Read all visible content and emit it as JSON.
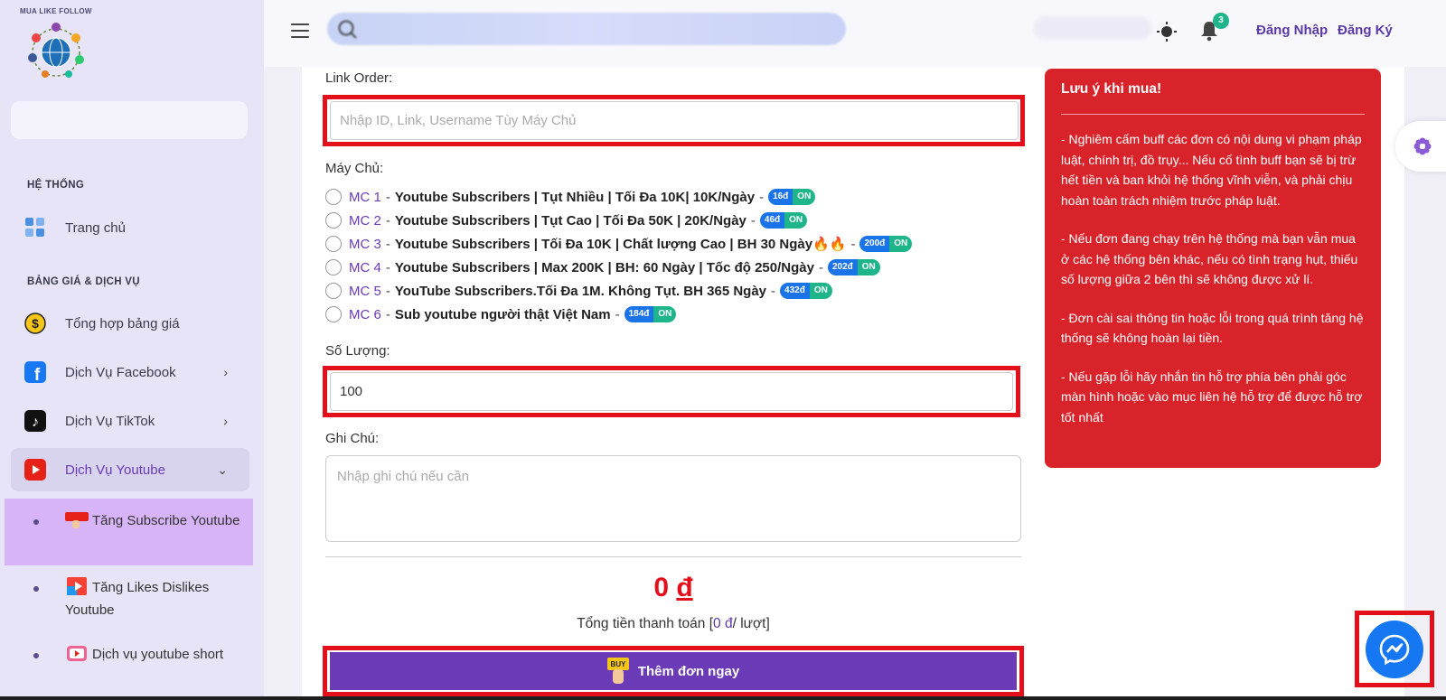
{
  "logo": {
    "text": "MUA LIKE FOLLOW"
  },
  "sidebar": {
    "section1": "HỆ THỐNG",
    "home": "Trang chủ",
    "section2": "BẢNG GIÁ & DỊCH VỤ",
    "items": [
      {
        "label": "Tổng hợp bảng giá"
      },
      {
        "label": "Dịch Vụ Facebook"
      },
      {
        "label": "Dịch Vụ TikTok"
      },
      {
        "label": "Dịch Vụ Youtube"
      }
    ],
    "sub_items": [
      {
        "label": "Tăng Subscribe Youtube"
      },
      {
        "label": "Tăng Likes Dislikes Youtube"
      },
      {
        "label": "Dịch vụ youtube short"
      }
    ]
  },
  "topbar": {
    "notif_count": "3",
    "login": "Đăng Nhập",
    "register": "Đăng Ký"
  },
  "form": {
    "link_label": "Link Order:",
    "link_placeholder": "Nhập ID, Link, Username Tùy Máy Chủ",
    "server_label": "Máy Chủ:",
    "servers": [
      {
        "code": "MC 1",
        "name": "Youtube Subscribers | Tụt Nhiều | Tối Đa 10K| 10K/Ngày",
        "price": "16đ",
        "status": "ON"
      },
      {
        "code": "MC 2",
        "name": "Youtube Subscribers | Tụt Cao | Tối Đa 50K | 20K/Ngày",
        "price": "46đ",
        "status": "ON"
      },
      {
        "code": "MC 3",
        "name": "Youtube Subscribers | Tối Đa 10K | Chất lượng Cao | BH 30 Ngày🔥🔥",
        "price": "200đ",
        "status": "ON"
      },
      {
        "code": "MC 4",
        "name": "Youtube Subscribers | Max 200K | BH: 60 Ngày | Tốc độ 250/Ngày",
        "price": "202đ",
        "status": "ON"
      },
      {
        "code": "MC 5",
        "name": "YouTube Subscribers.Tối Đa 1M. Không Tụt. BH 365 Ngày",
        "price": "432đ",
        "status": "ON"
      },
      {
        "code": "MC 6",
        "name": "Sub youtube người thật Việt Nam",
        "price": "184đ",
        "status": "ON"
      }
    ],
    "dash": "-",
    "qty_label": "Số Lượng:",
    "qty_value": "100",
    "note_label": "Ghi Chú:",
    "note_placeholder": "Nhập ghi chú nếu cần",
    "total_amount": "0",
    "total_currency": "đ",
    "total_label_prefix": "Tổng tiền thanh toán [",
    "total_label_price": "0 đ",
    "total_label_suffix": "/ lượt]",
    "buy_badge": "BUY",
    "buy_label": "Thêm đơn ngay"
  },
  "notice": {
    "title": "Lưu ý khi mua!",
    "paragraphs": [
      "- Nghiêm cấm buff các đơn có nội dung vi phạm pháp luật, chính trị, đồ trụy... Nếu cố tình buff bạn sẽ bị trừ hết tiền và ban khỏi hệ thống vĩnh viễn, và phải chịu hoàn toàn trách nhiệm trước pháp luật.",
      "- Nếu đơn đang chạy trên hệ thống mà bạn vẫn mua ở các hệ thống bên khác, nếu có tình trạng hụt, thiếu số lượng giữa 2 bên thì sẽ không được xử lí.",
      "- Đơn cài sai thông tin hoặc lỗi trong quá trình tăng hệ thống sẽ không hoàn lại tiền.",
      "- Nếu gặp lỗi hãy nhắn tin hỗ trợ phía bên phải góc màn hình hoặc vào mục liên hệ hỗ trợ để được hỗ trợ tốt nhất"
    ]
  },
  "colors": {
    "accent": "#6a3ab7",
    "danger": "#d8232b",
    "highlight": "#e3101b",
    "badge_price": "#1b73e8",
    "badge_on": "#1fb58a",
    "messenger": "#1677f2"
  }
}
